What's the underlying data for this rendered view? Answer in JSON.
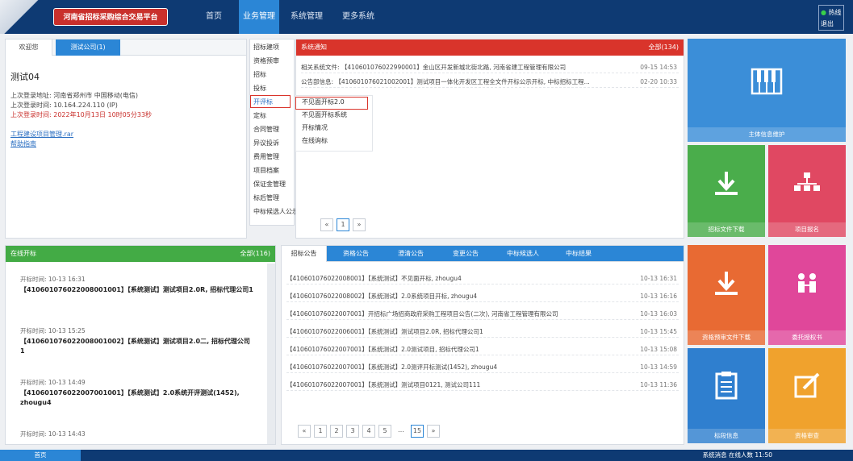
{
  "header": {
    "brand": "河南省招标采购综合交易平台",
    "nav": [
      "首页",
      "业务管理",
      "系统管理",
      "更多系统"
    ],
    "user_lines": [
      "热线",
      "退出"
    ]
  },
  "left_panel": {
    "tabs": [
      "欢迎您",
      "测试公司(1)"
    ],
    "title": "测试04",
    "lines": [
      "上次登录地址: 河南省郑州市 中国移动(电信)",
      "上次登录时间: 10.164.224.110 (IP)",
      "上次登录时间: 2022年10月13日 10时05分33秒"
    ],
    "links": [
      "工程建设项目管理.rar",
      "帮助指南"
    ]
  },
  "menu": {
    "items": [
      "招标建项",
      "资格预审",
      "招标",
      "投标",
      "开评标",
      "定标",
      "合同管理",
      "异议投诉",
      "费用管理",
      "项目档案",
      "保证金管理",
      "标后管理",
      "中标候选人公示"
    ],
    "highlight_index": 4,
    "sub_items": [
      "不见面开标2.0",
      "不见面开标系统",
      "开标情况",
      "在线询标"
    ]
  },
  "notice_panel": {
    "header": "系统通知",
    "more": "全部(134)",
    "rows": [
      {
        "text": "相关系统文件: 【410601076022990001】金山区开发新城北街北路, 河南省建工程管理有限公司",
        "date": "09-15 14:53"
      },
      {
        "text": "公告部信息: 【410601076021002001】测试项目一体化开发区工程全文件开标公示开标, 中标招标工程...",
        "date": "02-20 10:33"
      }
    ]
  },
  "todo_panel": {
    "header": "在线开标",
    "more": "全部(116)",
    "items": [
      {
        "time": "开标时间: 10-13 16:31",
        "title": "【410601076022008001001】【系统测试】测试项目2.0R, 招标代理公司1"
      },
      {
        "time": "开标时间: 10-13 15:25",
        "title": "【410601076022008001002】【系统测试】测试项目2.0二, 招标代理公司1"
      },
      {
        "time": "开标时间: 10-13 14:49",
        "title": "【410601076022007001001】【系统测试】2.0系统开评测试(1452), zhougu4"
      },
      {
        "time": "开标时间: 10-13 14:43",
        "title": ""
      }
    ]
  },
  "bid_panel": {
    "tabs": [
      "招标公告",
      "资格公告",
      "澄清公告",
      "变更公告",
      "中标候选人",
      "中标结果"
    ],
    "rows": [
      {
        "text": "【410601076022008001】【系统测试】不见面开标, zhougu4",
        "date": "10-13 16:31"
      },
      {
        "text": "【410601076022008002】【系统测试】2.0系统项目开标, zhougu4",
        "date": "10-13 16:16"
      },
      {
        "text": "【410601076022007001】开招标广场招商政府采购工程项目公告(二次), 河南省工程管理有限公司",
        "date": "10-13 16:03"
      },
      {
        "text": "【410601076022006001】【系统测试】测试项目2.0R, 招标代理公司1",
        "date": "10-13 15:45"
      },
      {
        "text": "【410601076022007001】【系统测试】2.0测试项目, 招标代理公司1",
        "date": "10-13 15:08"
      },
      {
        "text": "【410601076022007001】【系统测试】2.0测评开标测试(1452), zhougu4",
        "date": "10-13 14:59"
      },
      {
        "text": "【410601076022007001】【系统测试】测试项目0121, 测试公司111",
        "date": "10-13 11:36"
      }
    ],
    "pages": [
      "«",
      "1",
      "2",
      "3",
      "4",
      "5",
      "…",
      "15",
      "»"
    ],
    "current_page": "15"
  },
  "tiles": [
    {
      "label": "主体信息维护",
      "color": "#3b8ed8",
      "icon": "piano-icon"
    },
    {
      "label": "招标文件下载",
      "color": "#4aad4b",
      "icon": "download-icon"
    },
    {
      "label": "项目报名",
      "color": "#e04862",
      "icon": "org-icon"
    },
    {
      "label": "资格预审文件下载",
      "color": "#e86a33",
      "icon": "download-icon"
    },
    {
      "label": "委托授权书",
      "color": "#e0479a",
      "icon": "people-icon"
    },
    {
      "label": "标段信息",
      "color": "#2f7fcf",
      "icon": "doc-icon"
    },
    {
      "label": "资格审查",
      "color": "#f0a22d",
      "icon": "edit-icon"
    }
  ],
  "statusbar": {
    "start": "首页",
    "right": "系统消息   在线人数   11:50"
  }
}
